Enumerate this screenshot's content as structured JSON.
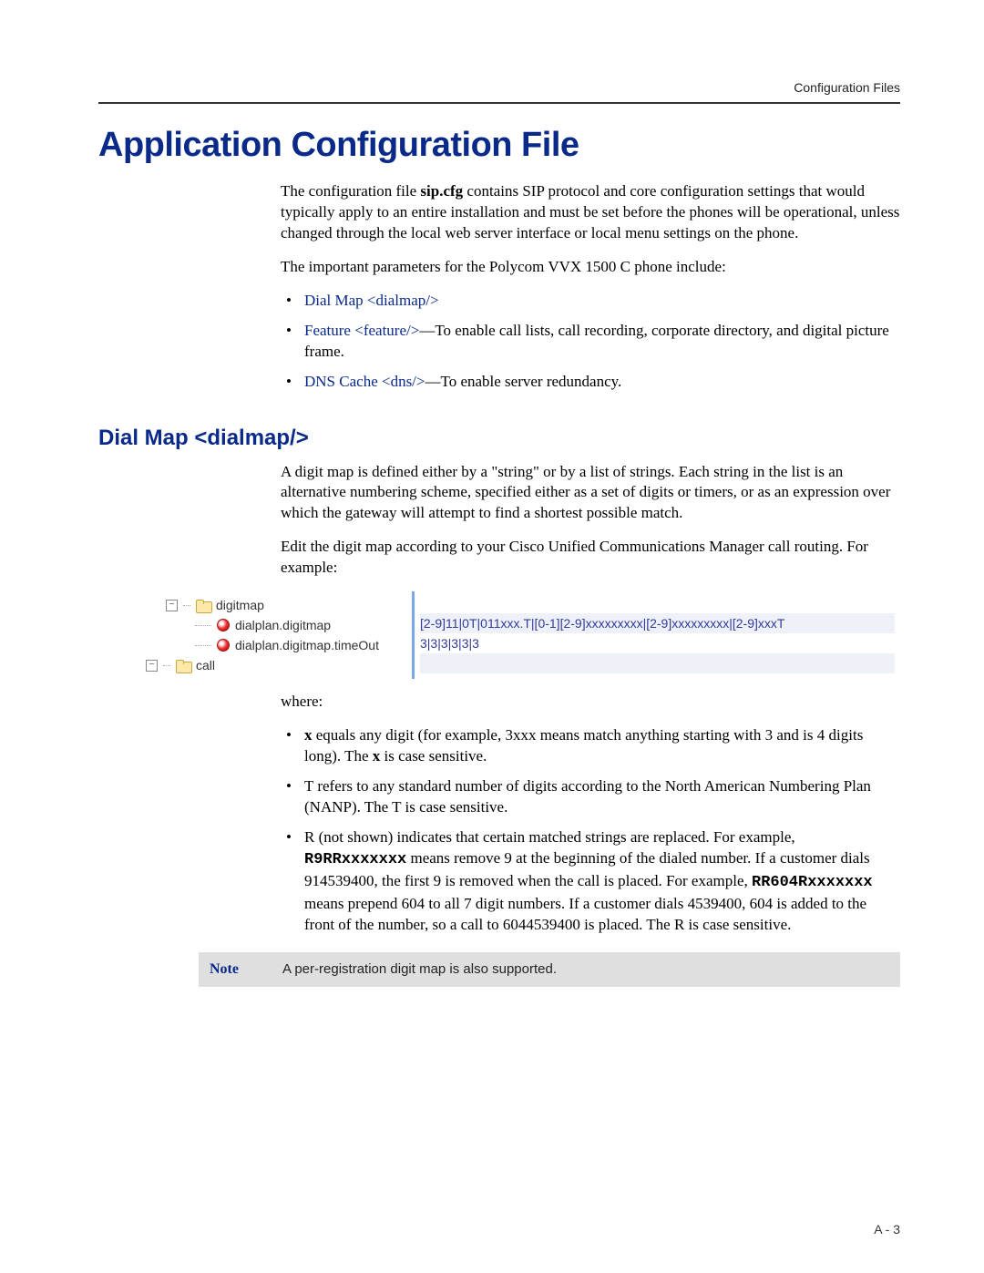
{
  "header": {
    "running": "Configuration Files"
  },
  "title": "Application Configuration File",
  "intro": {
    "p1a": "The configuration file ",
    "p1b": "sip.cfg",
    "p1c": " contains SIP protocol and core configuration settings that would typically apply to an entire installation and must be set before the phones will be operational, unless changed through the local web server interface or local menu settings on the phone.",
    "p2": "The important parameters for the Polycom VVX 1500 C phone include:"
  },
  "param_list": {
    "i1": "Dial Map <dialmap/>",
    "i2_link": "Feature <feature/>",
    "i2_rest": "—To enable call lists, call recording, corporate directory, and digital picture frame.",
    "i3_link": "DNS Cache <dns/>",
    "i3_rest": "—To enable server redundancy."
  },
  "section2": {
    "heading": "Dial Map <dialmap/>",
    "p1": "A digit map is defined either by a \"string\" or by a list of strings. Each string in the list is an alternative numbering scheme, specified either as a set of digits or timers, or as an expression over which the gateway will attempt to find a shortest possible match.",
    "p2": "Edit the digit map according to your Cisco Unified Communications Manager call routing. For example:"
  },
  "tree": {
    "n1": "digitmap",
    "n2": "dialplan.digitmap",
    "n3": "dialplan.digitmap.timeOut",
    "n4": "call",
    "v1": "[2-9]11|0T|011xxx.T|[0-1][2-9]xxxxxxxxx|[2-9]xxxxxxxxx|[2-9]xxxT",
    "v2": "3|3|3|3|3|3"
  },
  "where": {
    "lead": "where:",
    "b1a": "x",
    "b1b": " equals any digit (for example, 3xxx means match anything starting with 3 and is 4 digits long). The ",
    "b1c": "x",
    "b1d": " is case sensitive.",
    "b2": "T refers to any standard number of digits according to the North American Numbering Plan (NANP). The T is case sensitive.",
    "b3a": "R (not shown) indicates that certain matched strings are replaced. For example, ",
    "b3b": "R9RRxxxxxxx",
    "b3c": " means remove 9 at the beginning of the dialed number. If a customer dials 914539400, the first 9 is removed when the call is placed. For example, ",
    "b3d": "RR604Rxxxxxxx",
    "b3e": " means prepend 604 to all 7 digit numbers. If a customer dials 4539400, 604 is added to the front of the number, so a call to 6044539400 is placed. The R is case sensitive."
  },
  "note": {
    "label": "Note",
    "text": "A per-registration digit map is also supported."
  },
  "footer": {
    "pagenum": "A - 3"
  }
}
